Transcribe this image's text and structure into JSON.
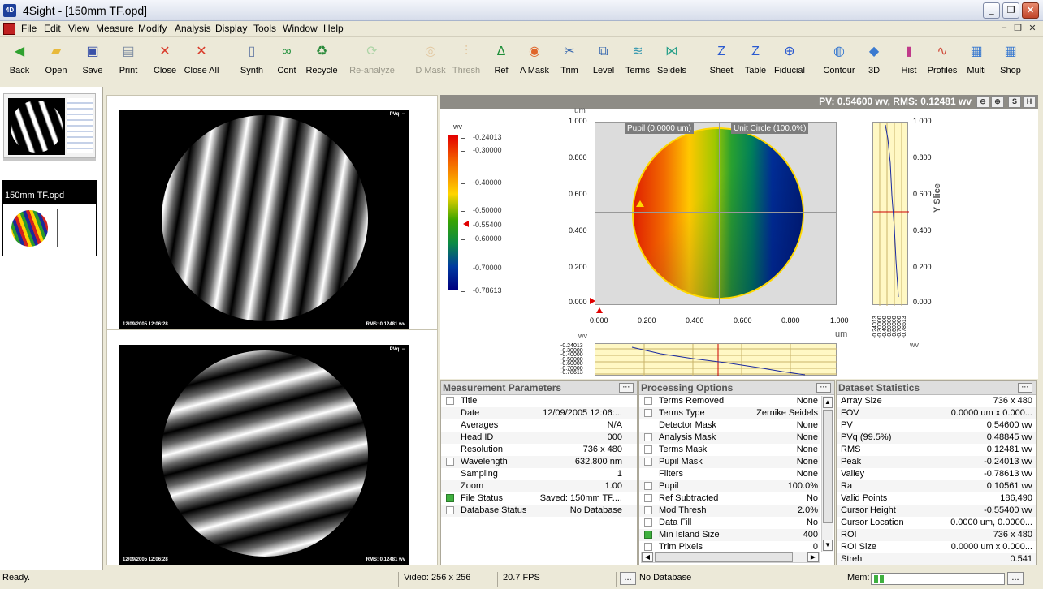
{
  "window": {
    "title": "4Sight - [150mm TF.opd]",
    "app_icon_text": "4D",
    "minimize": "_",
    "maximize": "❐",
    "close": "✕"
  },
  "menu": [
    "File",
    "Edit",
    "View",
    "Measure",
    "Modify",
    "Analysis",
    "Display",
    "Tools",
    "Window",
    "Help"
  ],
  "mdi_controls": [
    "–",
    "❐",
    "✕"
  ],
  "toolbar": [
    {
      "label": "Back",
      "icon": "back-arrow-icon",
      "glyph": "◀",
      "color": "#2fa12f",
      "enabled": true
    },
    {
      "label": "Open",
      "icon": "open-folder-icon",
      "glyph": "▰",
      "color": "#e8b93a",
      "enabled": true
    },
    {
      "label": "Save",
      "icon": "save-disk-icon",
      "glyph": "▣",
      "color": "#3a52a8",
      "enabled": true
    },
    {
      "label": "Print",
      "icon": "printer-icon",
      "glyph": "▤",
      "color": "#7a8aa0",
      "enabled": true
    },
    {
      "label": "Close",
      "icon": "close-file-icon",
      "glyph": "✕",
      "color": "#d93a2a",
      "enabled": true
    },
    {
      "label": "Close All",
      "icon": "close-all-icon",
      "glyph": "✕",
      "color": "#d93a2a",
      "enabled": true
    },
    {
      "label": "Synth",
      "icon": "synth-page-icon",
      "glyph": "▯",
      "color": "#6b7fa6",
      "enabled": true
    },
    {
      "label": "Cont",
      "icon": "continuous-icon",
      "glyph": "∞",
      "color": "#1f8f3a",
      "enabled": true
    },
    {
      "label": "Recycle",
      "icon": "recycle-icon",
      "glyph": "♻",
      "color": "#2a8a3a",
      "enabled": true
    },
    {
      "label": "Re-analyze",
      "icon": "reanalyze-icon",
      "glyph": "⟳",
      "color": "#3ab04a",
      "enabled": false
    },
    {
      "label": "D Mask",
      "icon": "detector-mask-icon",
      "glyph": "◎",
      "color": "#d08a3a",
      "enabled": false
    },
    {
      "label": "Thresh",
      "icon": "threshold-icon",
      "glyph": "⫶",
      "color": "#d08a3a",
      "enabled": false
    },
    {
      "label": "Ref",
      "icon": "reference-icon",
      "glyph": "Δ",
      "color": "#1f8f3a",
      "enabled": true
    },
    {
      "label": "A Mask",
      "icon": "analysis-mask-icon",
      "glyph": "◉",
      "color": "#e0652a",
      "enabled": true
    },
    {
      "label": "Trim",
      "icon": "trim-scissors-icon",
      "glyph": "✂",
      "color": "#3a6ab0",
      "enabled": true
    },
    {
      "label": "Level",
      "icon": "level-icon",
      "glyph": "⧉",
      "color": "#3a6ab0",
      "enabled": true
    },
    {
      "label": "Terms",
      "icon": "terms-icon",
      "glyph": "≋",
      "color": "#3a9ab0",
      "enabled": true
    },
    {
      "label": "Seidels",
      "icon": "seidels-icon",
      "glyph": "⋈",
      "color": "#2aa08a",
      "enabled": true
    },
    {
      "label": "Sheet",
      "icon": "sheet-icon",
      "glyph": "Z",
      "color": "#2a5ad0",
      "enabled": true
    },
    {
      "label": "Table",
      "icon": "table-icon",
      "glyph": "Z",
      "color": "#2a5ad0",
      "enabled": true
    },
    {
      "label": "Fiducial",
      "icon": "fiducial-icon",
      "glyph": "⊕",
      "color": "#2a5ad0",
      "enabled": true
    },
    {
      "label": "Contour",
      "icon": "contour-icon",
      "glyph": "◍",
      "color": "#3a7ad0",
      "enabled": true
    },
    {
      "label": "3D",
      "icon": "3d-view-icon",
      "glyph": "◆",
      "color": "#3a7ad0",
      "enabled": true
    },
    {
      "label": "Hist",
      "icon": "histogram-icon",
      "glyph": "▮",
      "color": "#c03a8a",
      "enabled": true
    },
    {
      "label": "Profiles",
      "icon": "profiles-icon",
      "glyph": "∿",
      "color": "#d04a3a",
      "enabled": true
    },
    {
      "label": "Multi",
      "icon": "multi-view-icon",
      "glyph": "▦",
      "color": "#3a7ad0",
      "enabled": true
    },
    {
      "label": "Shop",
      "icon": "shop-icon",
      "glyph": "▦",
      "color": "#3a7ad0",
      "enabled": true
    }
  ],
  "file_card": {
    "name": "150mm TF.opd"
  },
  "fringe_images": [
    {
      "pvq": "PVq: --",
      "date": "12/09/2005 12:06:28",
      "rms": "RMS: 0.12481 wv"
    },
    {
      "pvq": "PVq: --",
      "date": "12/09/2005 12:06:28",
      "rms": "RMS: 0.12481 wv"
    }
  ],
  "map_view": {
    "header": "PV: 0.54600 wv, RMS: 0.12481 wv",
    "header_buttons": [
      "⊖",
      "⊕",
      "S",
      "H"
    ],
    "unit_top": "um",
    "unit_bottom": "um",
    "pupil_label": "Pupil (0.0000 um)",
    "unit_circle_label": "Unit Circle (100.0%)",
    "y_slice_label": "Y Slice",
    "x_slice_unit": "wv",
    "y_slice_unit": "wv",
    "colorbar_unit": "wv",
    "colorbar_labels": [
      "-0.24013",
      "-0.30000",
      "-0.40000",
      "-0.50000",
      "-0.55400",
      "-0.60000",
      "-0.70000",
      "-0.78613"
    ],
    "y_ticks": [
      "1.000",
      "0.800",
      "0.600",
      "0.400",
      "0.200",
      "0.000"
    ],
    "x_ticks": [
      "0.000",
      "0.200",
      "0.400",
      "0.600",
      "0.800",
      "1.000"
    ],
    "slice_ticks": [
      "-0.24013",
      "-0.30000",
      "-0.40000",
      "-0.50000",
      "-0.60000",
      "-0.70000",
      "-0.78613"
    ]
  },
  "measurement_parameters": {
    "title": "Measurement Parameters",
    "rows": [
      {
        "k": "Title",
        "v": "",
        "chk": "off"
      },
      {
        "k": "Date",
        "v": "12/09/2005 12:06:...",
        "chk": "none"
      },
      {
        "k": "Averages",
        "v": "N/A",
        "chk": "none"
      },
      {
        "k": "Head ID",
        "v": "000",
        "chk": "none"
      },
      {
        "k": "Resolution",
        "v": "736 x 480",
        "chk": "none"
      },
      {
        "k": "Wavelength",
        "v": "632.800 nm",
        "chk": "off"
      },
      {
        "k": "Sampling",
        "v": "1",
        "chk": "none"
      },
      {
        "k": "Zoom",
        "v": "1.00",
        "chk": "none"
      },
      {
        "k": "File Status",
        "v": "Saved: 150mm TF....",
        "chk": "on"
      },
      {
        "k": "Database Status",
        "v": "No Database",
        "chk": "off"
      }
    ]
  },
  "processing_options": {
    "title": "Processing Options",
    "rows": [
      {
        "k": "Terms Removed",
        "v": "None",
        "chk": "off"
      },
      {
        "k": "Terms Type",
        "v": "Zernike Seidels",
        "chk": "off"
      },
      {
        "k": "Detector Mask",
        "v": "None",
        "chk": "none"
      },
      {
        "k": "Analysis Mask",
        "v": "None",
        "chk": "off"
      },
      {
        "k": "Terms Mask",
        "v": "None",
        "chk": "off"
      },
      {
        "k": "Pupil Mask",
        "v": "None",
        "chk": "off"
      },
      {
        "k": "Filters",
        "v": "None",
        "chk": "none"
      },
      {
        "k": "Pupil",
        "v": "100.0%",
        "chk": "off"
      },
      {
        "k": "Ref Subtracted",
        "v": "No",
        "chk": "off"
      },
      {
        "k": "Mod Thresh",
        "v": "2.0%",
        "chk": "off"
      },
      {
        "k": "Data Fill",
        "v": "No",
        "chk": "off"
      },
      {
        "k": "Min Island Size",
        "v": "400",
        "chk": "on"
      },
      {
        "k": "Trim Pixels",
        "v": "0",
        "chk": "off"
      }
    ]
  },
  "dataset_statistics": {
    "title": "Dataset Statistics",
    "rows": [
      {
        "k": "Array Size",
        "v": "736 x 480"
      },
      {
        "k": "FOV",
        "v": "0.0000 um x 0.000..."
      },
      {
        "k": "PV",
        "v": "0.54600 wv"
      },
      {
        "k": "PVq (99.5%)",
        "v": "0.48845 wv"
      },
      {
        "k": "RMS",
        "v": "0.12481 wv"
      },
      {
        "k": "Peak",
        "v": "-0.24013 wv"
      },
      {
        "k": "Valley",
        "v": "-0.78613 wv"
      },
      {
        "k": "Ra",
        "v": "0.10561 wv"
      },
      {
        "k": "Valid Points",
        "v": "186,490"
      },
      {
        "k": "Cursor Height",
        "v": "-0.55400 wv"
      },
      {
        "k": "Cursor Location",
        "v": "0.0000 um, 0.0000..."
      },
      {
        "k": "ROI",
        "v": "736 x 480"
      },
      {
        "k": "ROI Size",
        "v": "0.0000 um x 0.000..."
      },
      {
        "k": "Strehl",
        "v": "0.541"
      }
    ]
  },
  "status_bar": {
    "ready": "Ready.",
    "video": "Video: 256 x 256",
    "fps": "20.7 FPS",
    "db_button": "...",
    "database": "No Database",
    "mem_label": "Mem:",
    "mem_button": "..."
  }
}
